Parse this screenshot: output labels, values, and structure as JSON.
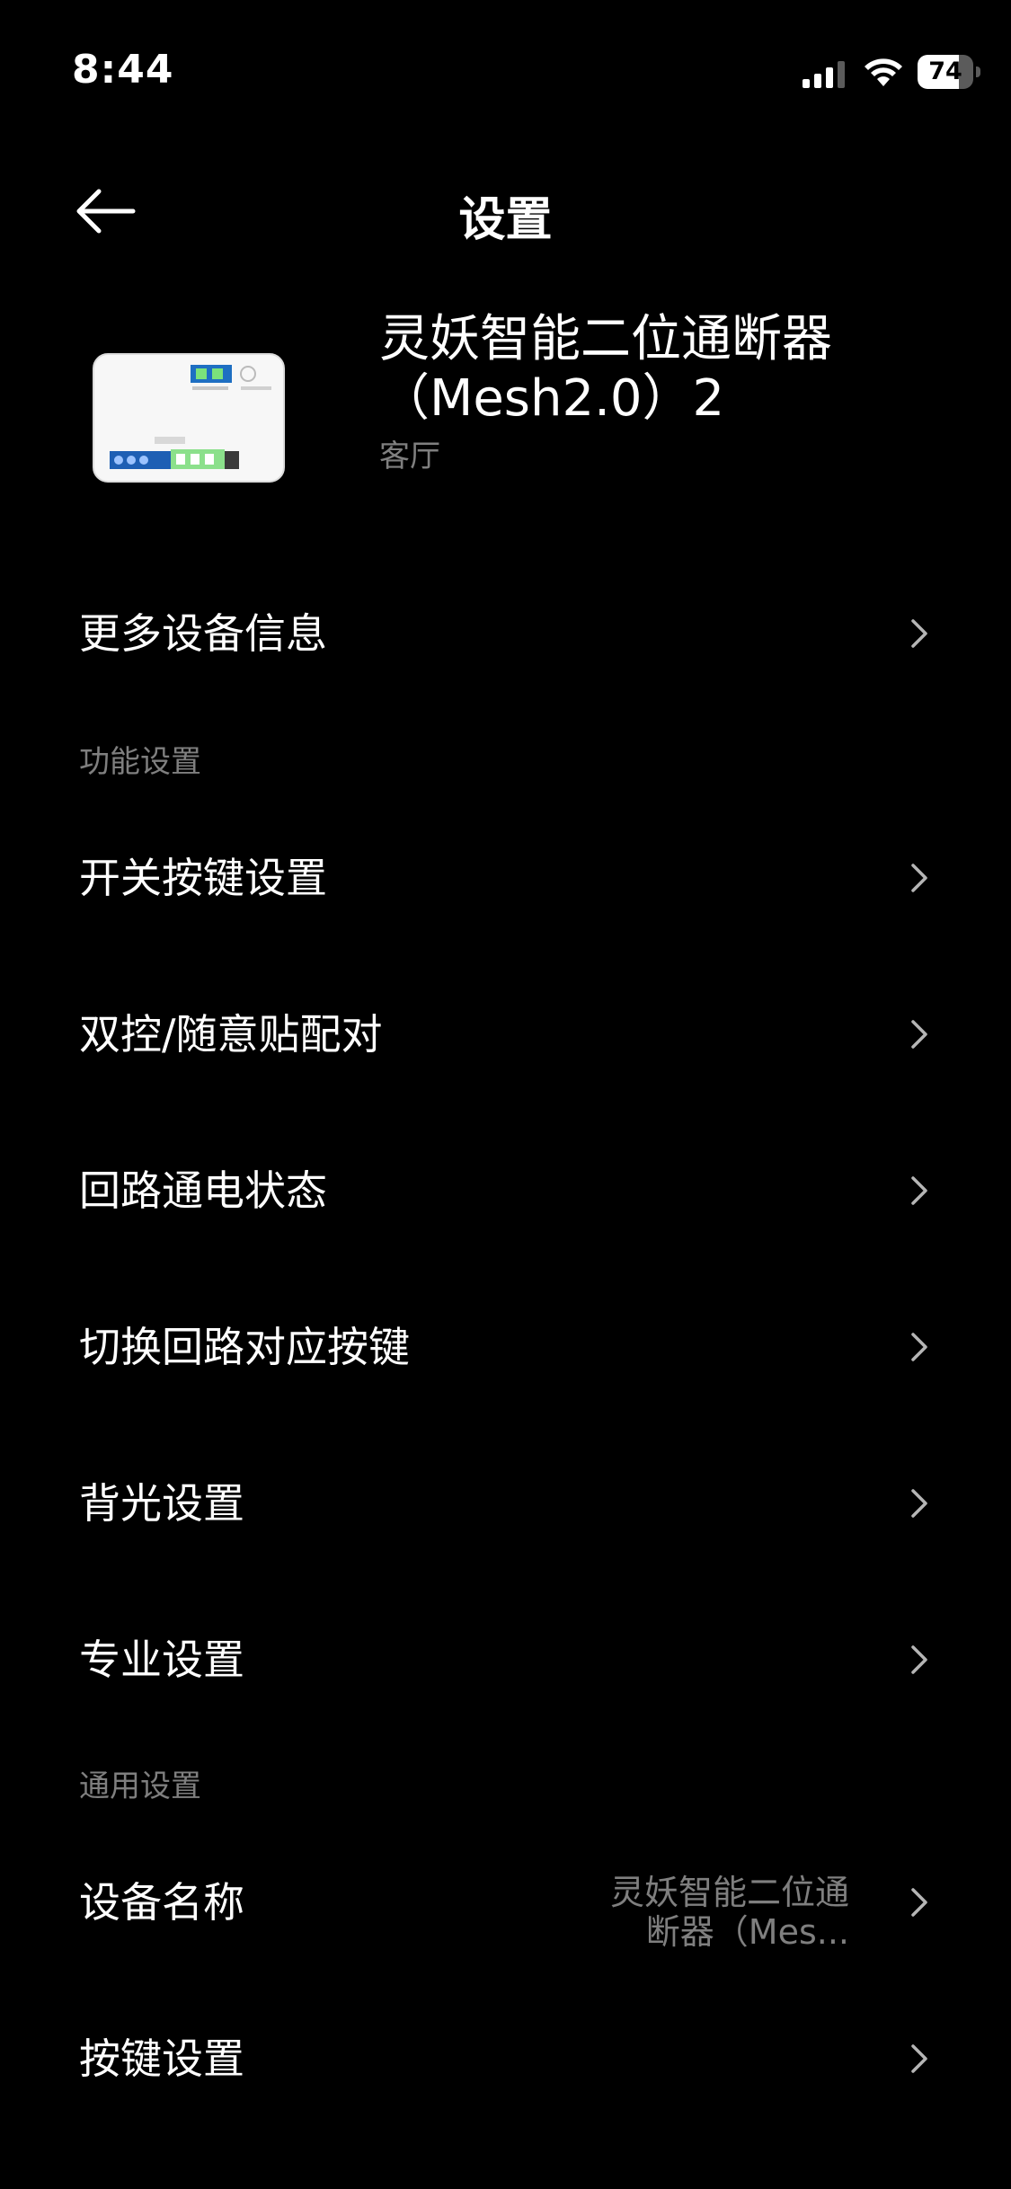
{
  "status_bar": {
    "time": "8:44",
    "battery_level": "74",
    "battery_fraction": 0.74,
    "icons": [
      "signal-icon",
      "wifi-icon",
      "battery-icon"
    ]
  },
  "nav": {
    "title": "设置",
    "back_icon": "arrow-left-icon"
  },
  "device": {
    "name": "灵妖智能二位通断器（Mesh2.0）2",
    "room": "客厅",
    "image_icon": "switch-module-image"
  },
  "rows": {
    "more_info": "更多设备信息",
    "section_function": "功能设置",
    "switch_key": "开关按键设置",
    "dual_control": "双控/随意贴配对",
    "circuit_power": "回路通电状态",
    "switch_circuit": "切换回路对应按键",
    "backlight": "背光设置",
    "professional": "专业设置",
    "section_general": "通用设置",
    "device_name": "设备名称",
    "device_name_value": "灵妖智能二位通断器（Mes...",
    "key_settings": "按键设置"
  },
  "colors": {
    "background": "#000000",
    "primary_text": "#ffffff",
    "secondary_text": "#7f7f7f"
  }
}
